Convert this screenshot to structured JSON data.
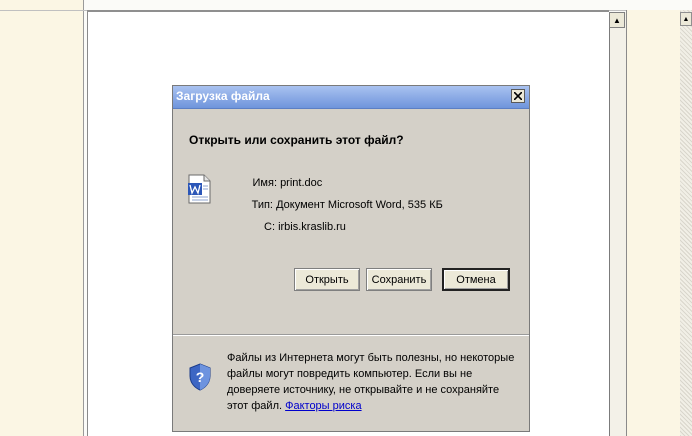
{
  "dialog": {
    "title": "Загрузка файла",
    "close_glyph": "✕",
    "question": "Открыть или сохранить этот файл?",
    "file": {
      "name_label": "Имя:",
      "name_value": "print.doc",
      "type_label": "Тип:",
      "type_value": "Документ Microsoft Word, 535 КБ",
      "from_label": "С:",
      "from_value": "irbis.kraslib.ru"
    },
    "buttons": {
      "open": "Открыть",
      "save": "Сохранить",
      "cancel": "Отмена"
    },
    "warning_text": "Файлы из Интернета могут быть полезны, но некоторые файлы могут повредить компьютер. Если вы не доверяете источнику, не открывайте и не сохраняйте этот файл.",
    "risk_link": "Факторы риска"
  },
  "scrollbar": {
    "up_arrow": "▲"
  },
  "icons": {
    "file": "word-document-icon",
    "warning": "shield-question-icon",
    "close": "close-icon"
  },
  "colors": {
    "dialog_bg": "#d4d0c8",
    "titlebar_start": "#a9c2f0",
    "titlebar_end": "#6f95dc",
    "link": "#0000cc"
  }
}
